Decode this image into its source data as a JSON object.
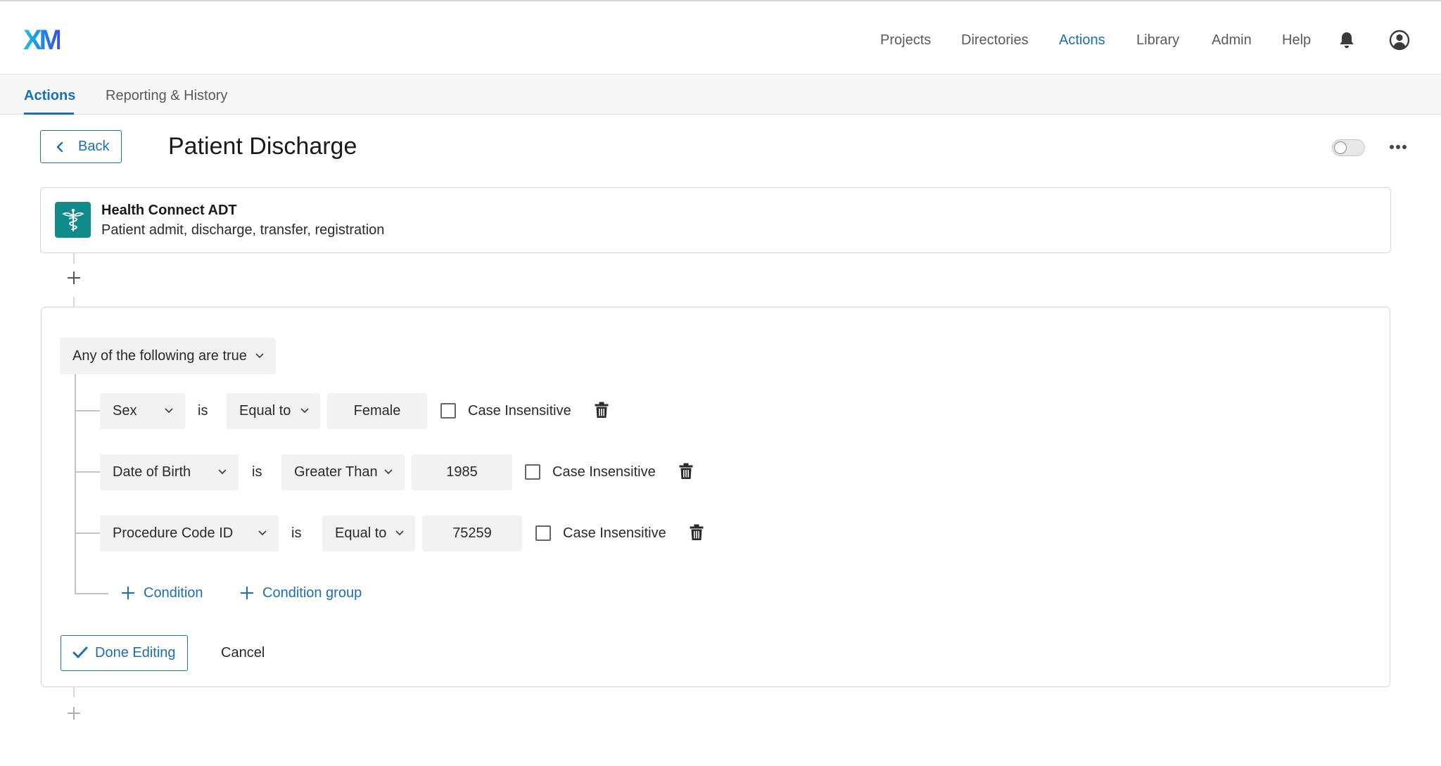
{
  "app": {
    "logo": "XM"
  },
  "nav": {
    "items": [
      {
        "label": "Projects",
        "active": false
      },
      {
        "label": "Directories",
        "active": false
      },
      {
        "label": "Actions",
        "active": true
      },
      {
        "label": "Library",
        "active": false
      },
      {
        "label": "Admin",
        "active": false
      },
      {
        "label": "Help",
        "active": false
      }
    ],
    "icons": [
      "bell-icon",
      "user-circle-icon"
    ]
  },
  "subtabs": {
    "items": [
      {
        "label": "Actions",
        "active": true
      },
      {
        "label": "Reporting & History",
        "active": false
      }
    ]
  },
  "header": {
    "back_label": "Back",
    "title": "Patient Discharge",
    "toggle_on": false
  },
  "trigger": {
    "title": "Health Connect ADT",
    "description": "Patient admit, discharge, transfer, registration",
    "icon": "caduceus-icon"
  },
  "conditions": {
    "group_label": "Any of the following are true",
    "rows": [
      {
        "field": "Sex",
        "is": "is",
        "operator": "Equal to",
        "value": "Female",
        "case_label": "Case Insensitive",
        "case_checked": false
      },
      {
        "field": "Date of Birth",
        "is": "is",
        "operator": "Greater Than",
        "value": "1985",
        "case_label": "Case Insensitive",
        "case_checked": false
      },
      {
        "field": "Procedure Code ID",
        "is": "is",
        "operator": "Equal to",
        "value": "75259",
        "case_label": "Case Insensitive",
        "case_checked": false
      }
    ],
    "add_condition_label": "Condition",
    "add_group_label": "Condition group"
  },
  "footer": {
    "done_label": "Done Editing",
    "cancel_label": "Cancel"
  },
  "colors": {
    "accent": "#1a6fb5",
    "trigger_badge": "#118a8c"
  }
}
